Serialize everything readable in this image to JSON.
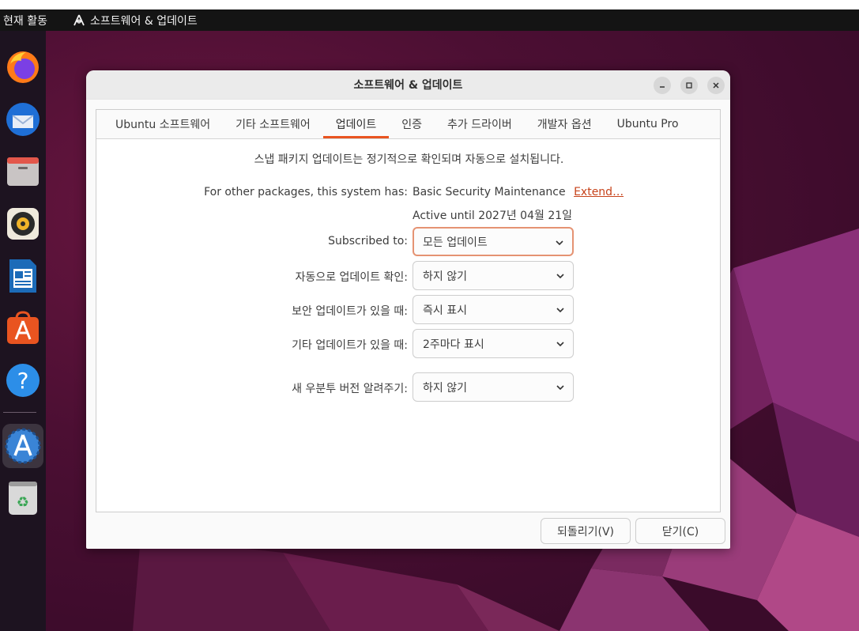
{
  "topbar": {
    "activities": "현재 활동",
    "app_name": "소프트웨어 & 업데이트"
  },
  "dock": {
    "items": [
      {
        "name": "firefox-icon"
      },
      {
        "name": "thunderbird-icon"
      },
      {
        "name": "files-icon"
      },
      {
        "name": "rhythmbox-icon"
      },
      {
        "name": "libreoffice-writer-icon"
      },
      {
        "name": "app-center-icon"
      },
      {
        "name": "help-icon"
      },
      {
        "name": "software-updates-icon"
      },
      {
        "name": "trash-icon"
      }
    ]
  },
  "window": {
    "title": "소프트웨어 & 업데이트",
    "tabs": [
      {
        "label": "Ubuntu 소프트웨어"
      },
      {
        "label": "기타 소프트웨어"
      },
      {
        "label": "업데이트",
        "active": true
      },
      {
        "label": "인증"
      },
      {
        "label": "추가 드라이버"
      },
      {
        "label": "개발자 옵션"
      },
      {
        "label": "Ubuntu Pro"
      }
    ],
    "snap_notice": "스냅 패키지 업데이트는 정기적으로 확인되며 자동으로 설치됩니다.",
    "other_packages_label": "For other packages, this system has:",
    "other_packages_value": "Basic Security Maintenance",
    "extend_link": "Extend…",
    "active_until": "Active until 2027년 04월 21일",
    "rows": [
      {
        "label": "Subscribed to:",
        "value": "모든 업데이트"
      },
      {
        "label": "자동으로 업데이트 확인:",
        "value": "하지 않기"
      },
      {
        "label": "보안 업데이트가 있을 때:",
        "value": "즉시 표시"
      },
      {
        "label": "기타 업데이트가 있을 때:",
        "value": "2주마다 표시"
      },
      {
        "label": "새 우분투 버전 알려주기:",
        "value": "하지 않기"
      }
    ],
    "revert_button": "되돌리기(V)",
    "close_button": "닫기(C)"
  },
  "colors": {
    "accent": "#e95420",
    "link": "#c7431b",
    "desktop": "#4c0f33"
  }
}
